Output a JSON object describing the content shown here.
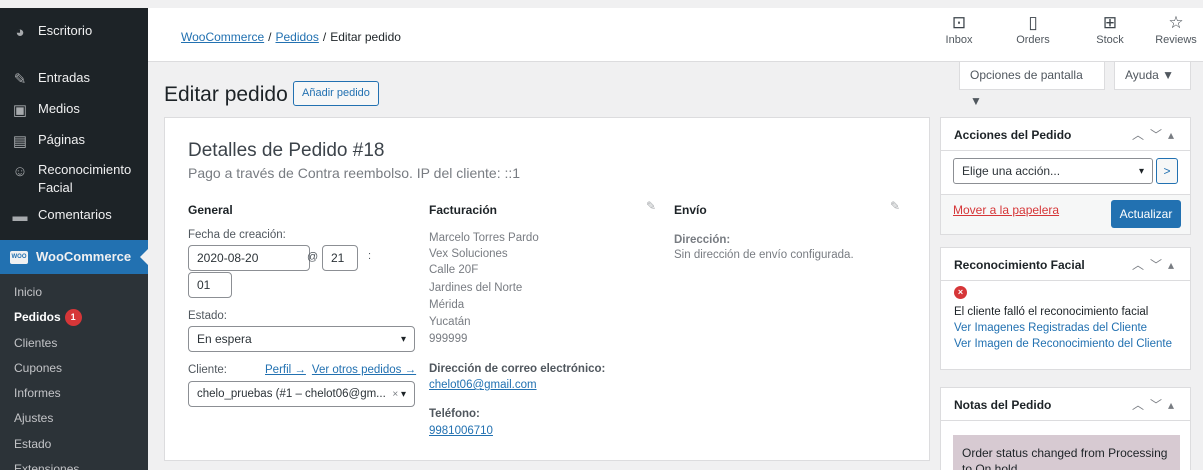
{
  "sidebar": {
    "items": [
      {
        "label": "Escritorio",
        "icon": "dashboard-icon"
      },
      {
        "label": "Entradas",
        "icon": "pin-icon"
      },
      {
        "label": "Medios",
        "icon": "media-icon"
      },
      {
        "label": "Páginas",
        "icon": "pages-icon"
      },
      {
        "label": "Reconocimiento Facial",
        "icon": "face-scan-icon"
      },
      {
        "label": "Comentarios",
        "icon": "comment-icon"
      },
      {
        "label": "WooCommerce",
        "icon": "woo-icon"
      }
    ],
    "woo_logo_text": "WOO",
    "submenu": [
      {
        "label": "Inicio"
      },
      {
        "label": "Pedidos",
        "badge": "1"
      },
      {
        "label": "Clientes"
      },
      {
        "label": "Cupones"
      },
      {
        "label": "Informes"
      },
      {
        "label": "Ajustes"
      },
      {
        "label": "Estado"
      },
      {
        "label": "Extensiones"
      }
    ]
  },
  "header": {
    "breadcrumb": {
      "woocommerce": "WooCommerce",
      "orders": "Pedidos",
      "current": "Editar pedido",
      "sep": "/"
    },
    "activity": [
      {
        "label": "Inbox",
        "icon": "inbox-icon"
      },
      {
        "label": "Orders",
        "icon": "orders-icon"
      },
      {
        "label": "Stock",
        "icon": "stock-icon"
      },
      {
        "label": "Reviews",
        "icon": "star-icon"
      }
    ],
    "screen_options": "Opciones de pantalla ▼",
    "help": "Ayuda ▼"
  },
  "page": {
    "title": "Editar pedido",
    "add_order": "Añadir pedido"
  },
  "order": {
    "heading": "Detalles de Pedido #18",
    "meta": "Pago a través de Contra reembolso. IP del cliente: ::1",
    "general": {
      "heading": "General",
      "created_label": "Fecha de creación:",
      "date": "2020-08-20",
      "at": "@",
      "hour": "21",
      "colon": ":",
      "minute": "01",
      "status_label": "Estado:",
      "status": "En espera",
      "customer_label": "Cliente:",
      "profile_link": "Perfil →",
      "other_orders_link": "Ver otros pedidos →",
      "customer": "chelo_pruebas (#1 – chelot06@gm...",
      "clear": "×"
    },
    "billing": {
      "heading": "Facturación",
      "address": [
        "Marcelo Torres Pardo",
        "Vex Soluciones",
        "Calle 20F",
        "Jardines del Norte",
        "Mérida",
        "Yucatán",
        "999999"
      ],
      "email_label": "Dirección de correo electrónico:",
      "email": "chelot06@gmail.com",
      "phone_label": "Teléfono:",
      "phone": "9981006710"
    },
    "shipping": {
      "heading": "Envío",
      "address_label": "Dirección:",
      "address": "Sin dirección de envío configurada."
    }
  },
  "side": {
    "actions": {
      "title": "Acciones del Pedido",
      "select": "Elige una acción...",
      "go": ">",
      "trash": "Mover a la papelera",
      "update": "Actualizar"
    },
    "face": {
      "title": "Reconocimiento Facial",
      "err_icon": "×",
      "message": "El cliente falló el reconocimiento facial",
      "link1": "Ver Imagenes Registradas del Cliente",
      "link2": "Ver Imagen de Reconocimiento del Cliente"
    },
    "notes": {
      "title": "Notas del Pedido",
      "note": "Order status changed from Processing to On hold."
    }
  },
  "colors": {
    "sidebar": "#1d2327",
    "accent": "#2271b1",
    "badge": "#d63638",
    "note": "#d7cad2"
  }
}
